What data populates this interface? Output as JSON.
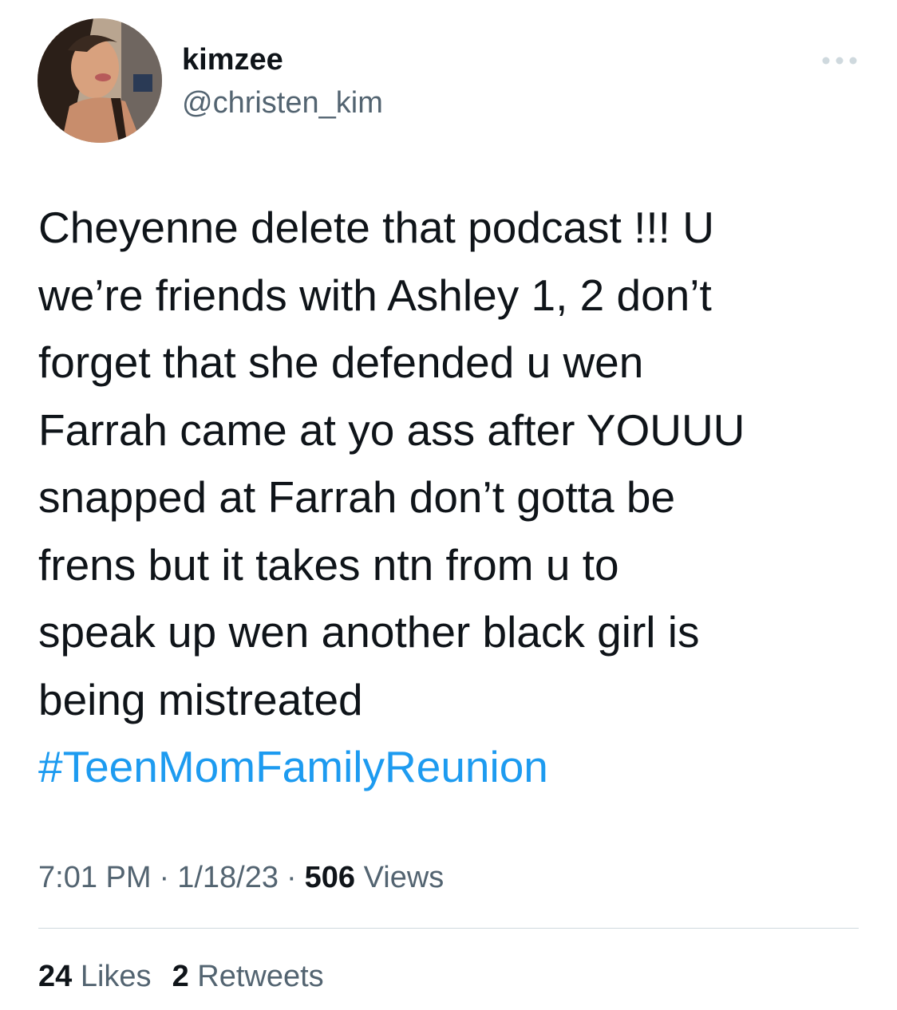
{
  "author": {
    "display_name": "kimzee",
    "handle": "@christen_kim",
    "avatar_icon": "profile-photo"
  },
  "more_icon": "more-options-icon",
  "tweet": {
    "lines": [
      "Cheyenne delete that podcast !!! U",
      "we’re friends with Ashley 1, 2 don’t",
      "forget that she defended u wen",
      "Farrah came at yo ass after YOUUU",
      "snapped at Farrah don’t gotta be",
      "frens but it takes ntn from u to",
      "speak up wen another black girl is",
      "being mistreated"
    ],
    "hashtag": "#TeenMomFamilyReunion"
  },
  "meta": {
    "time": "7:01 PM",
    "separator": "·",
    "date": "1/18/23",
    "views_count": "506",
    "views_label": "Views"
  },
  "stats": {
    "likes_count": "24",
    "likes_label": "Likes",
    "retweets_count": "2",
    "retweets_label": "Retweets"
  },
  "colors": {
    "text_primary": "#0f1419",
    "text_secondary": "#536471",
    "link": "#1d9bf0",
    "divider": "#cfd9de"
  }
}
